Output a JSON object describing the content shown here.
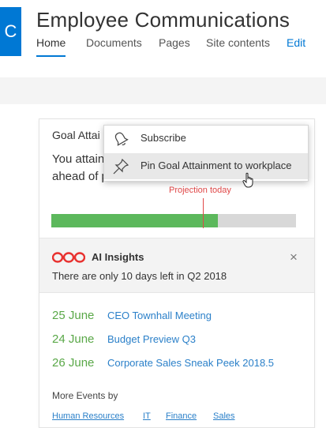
{
  "site": {
    "logo_letter": "C",
    "title": "Employee Communications"
  },
  "nav": {
    "items": [
      {
        "label": "Home",
        "active": true
      },
      {
        "label": "Documents"
      },
      {
        "label": "Pages"
      },
      {
        "label": "Site contents"
      }
    ],
    "edit_label": "Edit"
  },
  "goal_card": {
    "title": "Goal Attai",
    "text": "You attain",
    "text_line2": "ahead of pr",
    "projection_label": "Projection today",
    "progress_fraction": 0.68,
    "projection_fraction": 0.62
  },
  "context_menu": {
    "items": [
      {
        "label": "Subscribe",
        "icon": "bell-icon"
      },
      {
        "label": "Pin Goal Attainment to workplace",
        "icon": "pin-icon"
      }
    ]
  },
  "ai_insights": {
    "title": "AI Insights",
    "message": "There are only 10 days left in Q2 2018",
    "close_glyph": "×"
  },
  "events": [
    {
      "date": "25 June",
      "title": "CEO Townhall Meeting"
    },
    {
      "date": "24 June",
      "title": "Budget Preview Q3"
    },
    {
      "date": "26 June",
      "title": "Corporate Sales Sneak Peek 2018.5"
    }
  ],
  "more_events": {
    "label": "More Events by",
    "departments": [
      "Human Resources",
      "IT",
      "Finance",
      "Sales"
    ]
  },
  "colors": {
    "accent": "#0078d4",
    "progress_green": "#5cb85c",
    "projection_red": "#e04848",
    "event_date_green": "#5aa848",
    "link_blue": "#2b80c9",
    "ai_logo_red": "#e8312f"
  }
}
